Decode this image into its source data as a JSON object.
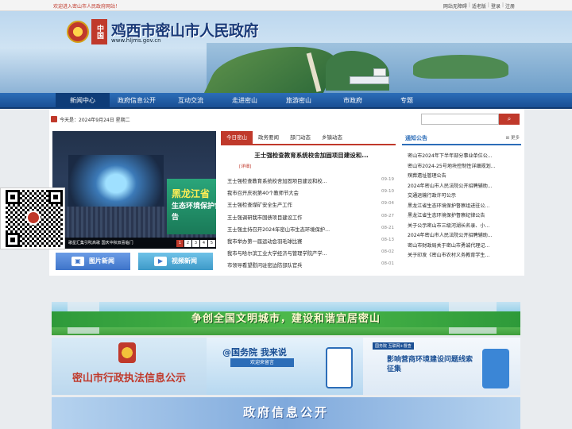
{
  "topbar": {
    "welcome": "欢迎进入密山市人民政府网站！",
    "links": [
      "网站无障碍",
      "适老版",
      "登录",
      "注册"
    ]
  },
  "header": {
    "badge": "中国",
    "title": "鸡西市密山市人民政府",
    "url": "www.hljms.gov.cn"
  },
  "nav": {
    "items": [
      "新闻中心",
      "政府信息公开",
      "互动交流",
      "走进密山",
      "旅游密山",
      "市政府",
      "专题"
    ],
    "active_index": 0
  },
  "datebar": {
    "text": "今天是：2024年9月24日 星期二"
  },
  "search": {
    "button_icon": "search-icon"
  },
  "slideshow": {
    "sign_title": "黑龙江省",
    "sign_subtitle": "生态环境保护督察组进驻公告",
    "caption": "歌星汇集引吭高歌 国庆中秋双喜临门",
    "pages": [
      "1",
      "2",
      "3",
      "4",
      "5"
    ],
    "active_page": 0
  },
  "buttons": {
    "pictures": "图片新闻",
    "videos": "视频新闻"
  },
  "news": {
    "tabs": [
      "今日密山",
      "政务要闻",
      "部门动态",
      "乡镇动态"
    ],
    "active_tab": 0,
    "headline": "王士强检查教育系统校舍加固项目建设和...",
    "detail_label": "[详细]",
    "items": [
      {
        "title": "王士强检查教育系统校舍加固项目建设和校...",
        "date": "09-19"
      },
      {
        "title": "我市召开庆祝第40个教师节大会",
        "date": "09-10"
      },
      {
        "title": "王士强检查煤矿安全生产工作",
        "date": "09-04"
      },
      {
        "title": "王士强调研我市国债项目建设工作",
        "date": "08-27"
      },
      {
        "title": "王士强主持召开2024年密山市生态环境保护...",
        "date": "08-21"
      },
      {
        "title": "我市举办第一届运动会羽毛球比赛",
        "date": "08-13"
      },
      {
        "title": "我市与哈尔滨工业大学经济与管理学院产学...",
        "date": "08-02"
      },
      {
        "title": "市领导看望慰问驻密边防部队官兵",
        "date": "08-01"
      }
    ]
  },
  "notices": {
    "title": "通知公告",
    "more": "更多",
    "items": [
      "密山市2024年下半年部分事业单位公...",
      "密山市2024-25号地块控制性详细规划...",
      "殡葬遗址管理公告",
      "2024年密山市人民法院公开招聘辅助...",
      "交通运输行政许可公示",
      "黑龙江省生态环境保护督察组进驻公...",
      "黑龙江省生态环境保护督察纪律公告",
      "关于公示密山市三级河湖长名录、小...",
      "2024年密山市人民法院公开招聘辅助...",
      "密山市财政局关于密山市勇诚代理记...",
      "关于印发《密山市农村义务教育学生..."
    ]
  },
  "banners": {
    "civic": "争创全国文明城市，建设和谐宜居密山",
    "enforcement": "密山市行政执法信息公示",
    "state_council": "@国务院 我来说",
    "state_council_sub": "欢迎来留言",
    "business_tag": "国务院 互联网+督查",
    "business": "影响营商环境建设问题线索征集",
    "gov_info": "政府信息公开"
  },
  "colors": {
    "nav_blue": "#1a4f94",
    "accent_red": "#c0392b",
    "green_banner": "#3f9e3b"
  }
}
